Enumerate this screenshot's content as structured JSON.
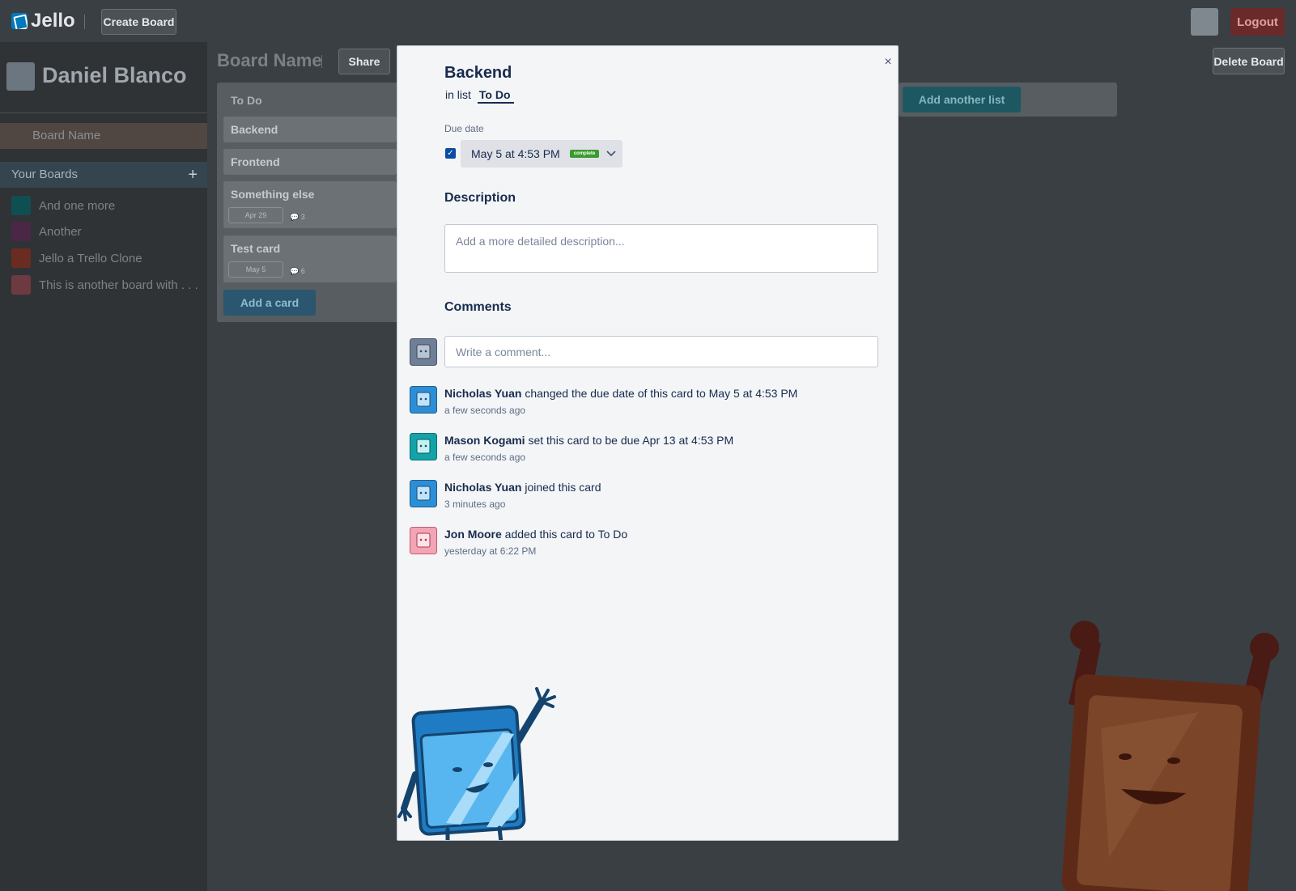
{
  "app": {
    "logo_text": "Jello",
    "create_board": "Create Board",
    "logout": "Logout"
  },
  "sidebar": {
    "profile_name": "Daniel Blanco",
    "current_board": "Board Name",
    "your_boards_label": "Your Boards",
    "add_icon": "plus-icon",
    "boards": [
      {
        "label": "And one more",
        "color": "#0f4f52"
      },
      {
        "label": "Another",
        "color": "#4a2747"
      },
      {
        "label": "Jello a Trello Clone",
        "color": "#6a2c20"
      },
      {
        "label": "This is another board with . . .",
        "color": "#6e3a41"
      }
    ]
  },
  "board": {
    "title": "Board Name",
    "share": "Share",
    "delete": "Delete Board",
    "add_list": "Add another list",
    "list": {
      "title": "To Do",
      "cards": [
        {
          "title": "Backend"
        },
        {
          "title": "Frontend"
        },
        {
          "title": "Something else",
          "due": "Apr 29",
          "comments": "3"
        },
        {
          "title": "Test card",
          "due": "May 5",
          "comments": "6"
        }
      ],
      "add_card": "Add a card"
    }
  },
  "modal": {
    "close": "×",
    "title": "Backend",
    "in_list_prefix": "in list",
    "list_name": "To Do",
    "due_label": "Due date",
    "due_checked": true,
    "due_value": "May 5 at 4:53 PM",
    "due_badge": "complete",
    "description_title": "Description",
    "description_placeholder": "Add a more detailed description...",
    "comments_title": "Comments",
    "comment_placeholder": "Write a comment...",
    "activities": [
      {
        "name": "Nicholas Yuan",
        "text": "changed the due date of this card to May 5 at 4:53 PM",
        "time": "a few seconds ago",
        "avatar_color": "#2c8fd6"
      },
      {
        "name": "Mason Kogami",
        "text": "set this card to be due Apr 13 at 4:53 PM",
        "time": "a few seconds ago",
        "avatar_color": "#12a3a8"
      },
      {
        "name": "Nicholas Yuan",
        "text": "joined this card",
        "time": "3 minutes ago",
        "avatar_color": "#2c8fd6"
      },
      {
        "name": "Jon Moore",
        "text": "added this card to To Do",
        "time": "yesterday at 6:22 PM",
        "avatar_color": "#f3a4b5"
      }
    ]
  }
}
